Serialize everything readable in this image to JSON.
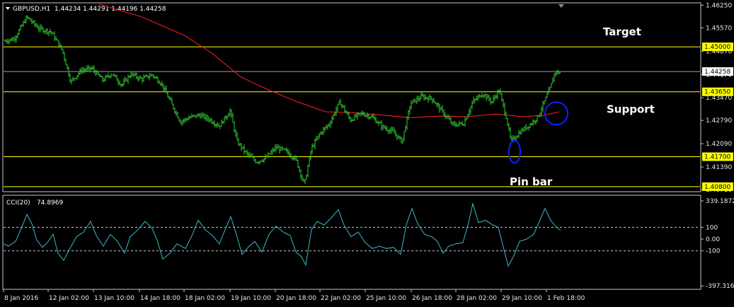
{
  "chart_data": [
    {
      "type": "candlestick",
      "header": {
        "symbol": "GBPUSD,H1",
        "ohlc": "1.44234 1.44291 1.44196 1.44258"
      },
      "ylim": [
        1.4067,
        1.463
      ],
      "yticks": [
        "1.46250",
        "1.45570",
        "1.44870",
        "1.44170",
        "1.43470",
        "1.42790",
        "1.42090",
        "1.41390",
        "1.40710"
      ],
      "xticks": [
        "8 Jan 2016",
        "12 Jan 02:00",
        "13 Jan 10:00",
        "14 Jan 18:00",
        "18 Jan 02:00",
        "19 Jan 10:00",
        "20 Jan 18:00",
        "22 Jan 02:00",
        "25 Jan 10:00",
        "26 Jan 18:00",
        "28 Jan 02:00",
        "29 Jan 10:00",
        "1 Feb 18:00"
      ],
      "horizontal_levels": [
        {
          "value": 1.45,
          "label": "1.45000",
          "color": "#ffff00"
        },
        {
          "value": 1.4365,
          "label": "1.43650",
          "color": "#ffff00"
        },
        {
          "value": 1.417,
          "label": "1.41700",
          "color": "#ffff00"
        },
        {
          "value": 1.408,
          "label": "1.40800",
          "color": "#ffff00"
        },
        {
          "value": 1.44258,
          "label": "1.44258",
          "color": "#9aa0b0"
        }
      ],
      "annotations": [
        {
          "text": "Target",
          "near_value": 1.4545
        },
        {
          "text": "Support",
          "near_value": 1.4312
        },
        {
          "text": "Pin bar",
          "near_value": 1.4095
        }
      ],
      "price_path": [
        [
          0,
          1.4515
        ],
        [
          20,
          1.4524
        ],
        [
          38,
          1.4589
        ],
        [
          55,
          1.4555
        ],
        [
          72,
          1.4545
        ],
        [
          88,
          1.449
        ],
        [
          100,
          1.4395
        ],
        [
          115,
          1.443
        ],
        [
          130,
          1.4435
        ],
        [
          145,
          1.44
        ],
        [
          158,
          1.442
        ],
        [
          172,
          1.4385
        ],
        [
          185,
          1.4418
        ],
        [
          200,
          1.4403
        ],
        [
          215,
          1.4416
        ],
        [
          228,
          1.439
        ],
        [
          242,
          1.433
        ],
        [
          255,
          1.4275
        ],
        [
          268,
          1.4288
        ],
        [
          282,
          1.4295
        ],
        [
          296,
          1.4282
        ],
        [
          310,
          1.4262
        ],
        [
          325,
          1.4308
        ],
        [
          335,
          1.4215
        ],
        [
          348,
          1.418
        ],
        [
          362,
          1.4155
        ],
        [
          375,
          1.4165
        ],
        [
          390,
          1.4198
        ],
        [
          405,
          1.4185
        ],
        [
          418,
          1.4163
        ],
        [
          430,
          1.4085
        ],
        [
          440,
          1.4195
        ],
        [
          452,
          1.424
        ],
        [
          465,
          1.4268
        ],
        [
          480,
          1.4335
        ],
        [
          495,
          1.428
        ],
        [
          510,
          1.43
        ],
        [
          525,
          1.429
        ],
        [
          540,
          1.426
        ],
        [
          555,
          1.4245
        ],
        [
          568,
          1.4215
        ],
        [
          580,
          1.433
        ],
        [
          595,
          1.435
        ],
        [
          610,
          1.4345
        ],
        [
          625,
          1.4305
        ],
        [
          640,
          1.4265
        ],
        [
          655,
          1.427
        ],
        [
          668,
          1.4335
        ],
        [
          682,
          1.436
        ],
        [
          695,
          1.4335
        ],
        [
          705,
          1.437
        ],
        [
          715,
          1.429
        ],
        [
          722,
          1.4215
        ],
        [
          735,
          1.4245
        ],
        [
          748,
          1.4265
        ],
        [
          760,
          1.429
        ],
        [
          770,
          1.434
        ],
        [
          778,
          1.438
        ],
        [
          784,
          1.4425
        ],
        [
          792,
          1.4422
        ]
      ],
      "ma_series": {
        "name": "",
        "color": "#ff2020",
        "points": [
          [
            140,
            1.4628
          ],
          [
            200,
            1.459
          ],
          [
            260,
            1.4535
          ],
          [
            300,
            1.448
          ],
          [
            340,
            1.441
          ],
          [
            380,
            1.437
          ],
          [
            420,
            1.4335
          ],
          [
            460,
            1.4305
          ],
          [
            500,
            1.4302
          ],
          [
            540,
            1.4295
          ],
          [
            580,
            1.4287
          ],
          [
            620,
            1.4292
          ],
          [
            660,
            1.429
          ],
          [
            700,
            1.4298
          ],
          [
            740,
            1.429
          ],
          [
            770,
            1.4295
          ],
          [
            790,
            1.4305
          ]
        ]
      },
      "markers": [
        {
          "shape": "ellipse",
          "x": 727,
          "y": 1.4185,
          "color": "#1020ff"
        },
        {
          "shape": "circle",
          "x": 786,
          "y": 1.43,
          "color": "#1020ff"
        }
      ]
    },
    {
      "type": "line",
      "header": {
        "name": "CCI(20)",
        "value": "74.8969"
      },
      "ylim": [
        -420,
        360
      ],
      "yticks": [
        "339.1872",
        "100",
        "0.00",
        "-100",
        "-397.3163"
      ],
      "reference_lines": [
        100,
        -100
      ],
      "series": [
        {
          "name": "",
          "color": "#3fb8c4",
          "points": [
            [
              5,
              -40
            ],
            [
              12,
              -60
            ],
            [
              22,
              -20
            ],
            [
              30,
              90
            ],
            [
              38,
              210
            ],
            [
              45,
              130
            ],
            [
              52,
              -10
            ],
            [
              60,
              -70
            ],
            [
              68,
              -20
            ],
            [
              75,
              40
            ],
            [
              82,
              -120
            ],
            [
              90,
              -180
            ],
            [
              98,
              -90
            ],
            [
              108,
              20
            ],
            [
              118,
              60
            ],
            [
              128,
              150
            ],
            [
              136,
              30
            ],
            [
              146,
              -60
            ],
            [
              156,
              40
            ],
            [
              166,
              -20
            ],
            [
              176,
              -120
            ],
            [
              184,
              20
            ],
            [
              195,
              80
            ],
            [
              205,
              150
            ],
            [
              215,
              90
            ],
            [
              222,
              -10
            ],
            [
              230,
              -170
            ],
            [
              240,
              -120
            ],
            [
              250,
              -40
            ],
            [
              262,
              -80
            ],
            [
              272,
              40
            ],
            [
              280,
              160
            ],
            [
              290,
              80
            ],
            [
              300,
              30
            ],
            [
              310,
              -40
            ],
            [
              318,
              80
            ],
            [
              326,
              190
            ],
            [
              334,
              40
            ],
            [
              342,
              -130
            ],
            [
              352,
              -60
            ],
            [
              360,
              -20
            ],
            [
              370,
              -110
            ],
            [
              380,
              40
            ],
            [
              390,
              110
            ],
            [
              400,
              60
            ],
            [
              410,
              30
            ],
            [
              418,
              -110
            ],
            [
              426,
              -150
            ],
            [
              432,
              -220
            ],
            [
              440,
              80
            ],
            [
              448,
              150
            ],
            [
              458,
              120
            ],
            [
              468,
              180
            ],
            [
              478,
              250
            ],
            [
              486,
              120
            ],
            [
              496,
              20
            ],
            [
              506,
              60
            ],
            [
              516,
              -30
            ],
            [
              526,
              -80
            ],
            [
              536,
              -60
            ],
            [
              546,
              -80
            ],
            [
              556,
              -70
            ],
            [
              566,
              -130
            ],
            [
              574,
              120
            ],
            [
              582,
              260
            ],
            [
              590,
              130
            ],
            [
              600,
              40
            ],
            [
              610,
              20
            ],
            [
              618,
              -20
            ],
            [
              626,
              -120
            ],
            [
              634,
              -60
            ],
            [
              644,
              -40
            ],
            [
              654,
              -30
            ],
            [
              662,
              140
            ],
            [
              668,
              300
            ],
            [
              676,
              140
            ],
            [
              686,
              160
            ],
            [
              696,
              120
            ],
            [
              704,
              100
            ],
            [
              712,
              -90
            ],
            [
              718,
              -230
            ],
            [
              726,
              -140
            ],
            [
              734,
              -20
            ],
            [
              744,
              0
            ],
            [
              754,
              40
            ],
            [
              762,
              150
            ],
            [
              770,
              260
            ],
            [
              778,
              160
            ],
            [
              786,
              100
            ],
            [
              792,
              75
            ]
          ]
        }
      ]
    }
  ]
}
